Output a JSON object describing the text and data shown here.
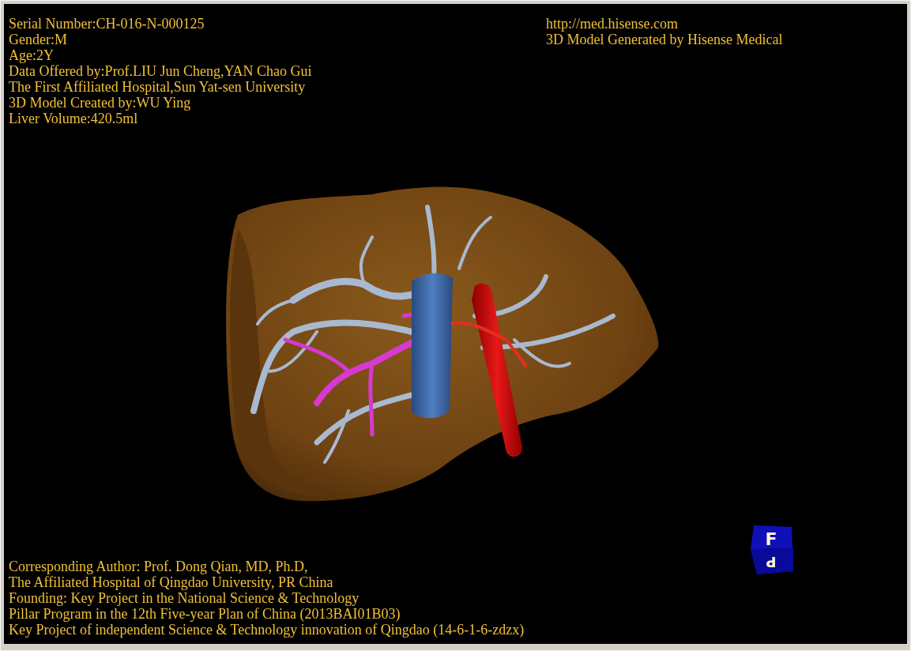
{
  "viewer": {
    "header_left": [
      "Serial Number:CH-016-N-000125",
      "Gender:M",
      "Age:2Y",
      "Data Offered by:Prof.LIU Jun Cheng,YAN Chao Gui",
      "The First Affiliated Hospital,Sun Yat-sen University",
      "3D Model Created by:WU Ying",
      "Liver Volume:420.5ml"
    ],
    "header_right": [
      "http://med.hisense.com",
      "3D Model Generated by Hisense Medical"
    ],
    "footer": [
      "Corresponding Author: Prof. Dong Qian, MD, Ph.D,",
      "The Affiliated Hospital of Qingdao University, PR China",
      "Founding: Key Project in the National Science & Technology",
      "Pillar Program in the 12th Five-year Plan of China (2013BAI01B03)",
      "Key Project of independent Science & Technology innovation of Qingdao (14-6-1-6-zdzx)"
    ],
    "orientation_cube": {
      "front": "F",
      "bottom": "P"
    }
  }
}
